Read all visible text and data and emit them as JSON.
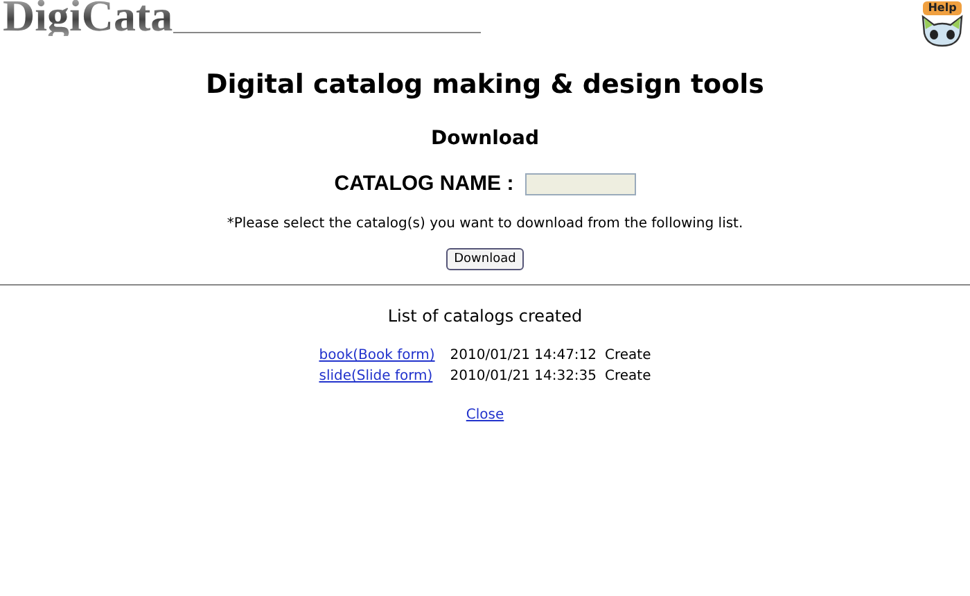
{
  "logo": "DigiCata",
  "help": {
    "label": "Help"
  },
  "title": "Digital catalog making & design tools",
  "subtitle": "Download",
  "catalog_name": {
    "label": "CATALOG NAME :"
  },
  "note": "*Please select the catalog(s) you want to download from the following list.",
  "download_button": "Download",
  "list": {
    "heading": "List of catalogs created",
    "rows": [
      {
        "name": "book(Book form)",
        "date": "2010/01/21 14:47:12",
        "action": "Create"
      },
      {
        "name": "slide(Slide form)",
        "date": "2010/01/21 14:32:35",
        "action": "Create"
      }
    ]
  },
  "close_link": "Close"
}
